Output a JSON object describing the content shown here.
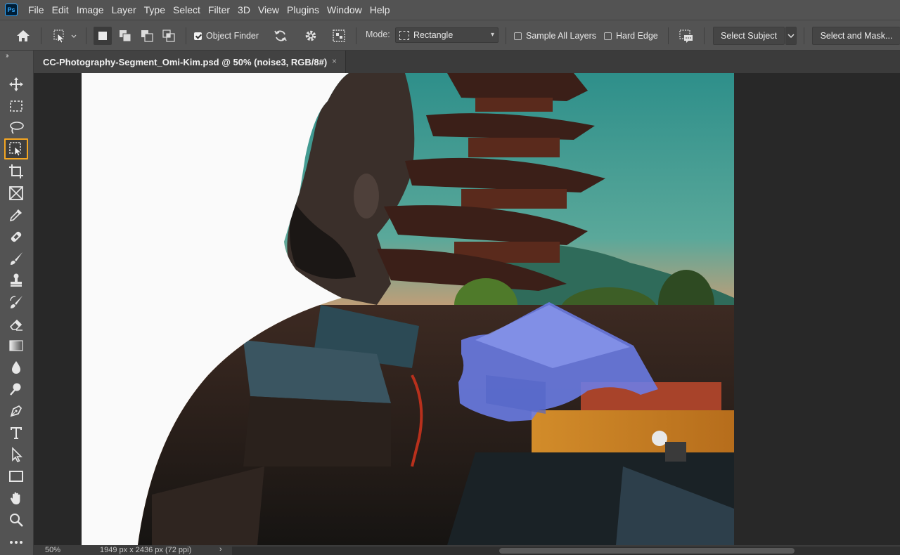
{
  "app": {
    "logo": "Ps"
  },
  "menu": [
    "File",
    "Edit",
    "Image",
    "Layer",
    "Type",
    "Select",
    "Filter",
    "3D",
    "View",
    "Plugins",
    "Window",
    "Help"
  ],
  "options": {
    "object_finder_label": "Object Finder",
    "object_finder_checked": true,
    "mode_label": "Mode:",
    "mode_value": "Rectangle",
    "sample_all_layers_label": "Sample All Layers",
    "sample_all_layers_checked": false,
    "hard_edge_label": "Hard Edge",
    "hard_edge_checked": false,
    "select_subject_label": "Select Subject",
    "select_and_mask_label": "Select and Mask..."
  },
  "document": {
    "tab_title": "CC-Photography-Segment_Omi-Kim.psd @ 50% (noise3, RGB/8#)",
    "close_glyph": "×"
  },
  "toolbar": {
    "active_tool": "object-selection-tool",
    "tools": [
      "move",
      "rectangular-marquee",
      "lasso",
      "object-selection",
      "crop",
      "frame",
      "eyedropper",
      "spot-healing-brush",
      "brush",
      "clone-stamp",
      "history-brush",
      "eraser",
      "gradient",
      "blur",
      "dodge",
      "pen",
      "type",
      "path-selection",
      "rectangle",
      "hand",
      "zoom",
      "more"
    ]
  },
  "status": {
    "zoom": "50%",
    "doc_info": "1949 px x 2436 px (72 ppi)",
    "arrow": "›"
  },
  "colors": {
    "accent": "#f4a622",
    "panel": "#535353",
    "selection_overlay": "#6b7de8"
  }
}
